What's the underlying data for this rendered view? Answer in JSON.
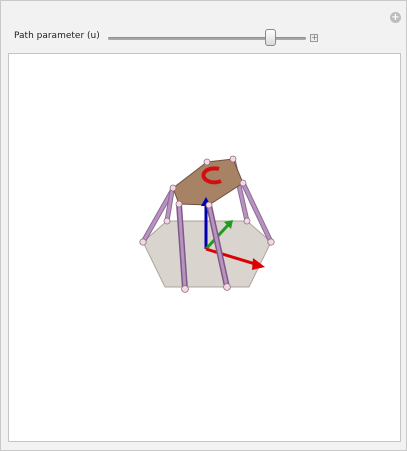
{
  "controls": {
    "slider_label": "Path parameter (u)",
    "slider_value_fraction": 0.82,
    "add_icon": "plus-circle-icon",
    "expand_icon": "plus-square-icon"
  },
  "colors": {
    "panel_bg": "#f2f2f2",
    "base_plate": "#d9d2cc",
    "top_plate": "#a88264",
    "legs": "#a97fb0",
    "joints": "#f4d9e4",
    "axis_x": "#dd0000",
    "axis_y": "#1f9c1f",
    "axis_z": "#0000b0",
    "rotation_marker": "#d01010"
  }
}
